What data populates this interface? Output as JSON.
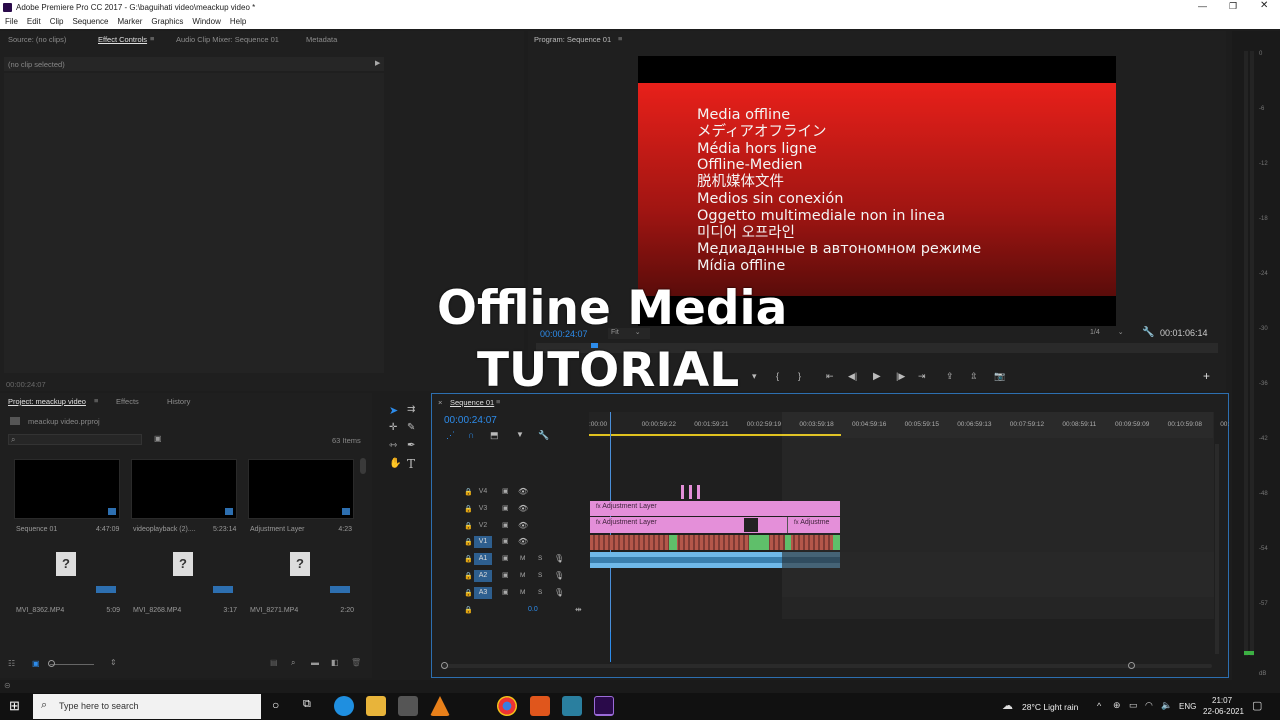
{
  "window": {
    "title": "Adobe Premiere Pro CC 2017 - G:\\baguihati video\\meackup video *"
  },
  "menu": [
    "File",
    "Edit",
    "Clip",
    "Sequence",
    "Marker",
    "Graphics",
    "Window",
    "Help"
  ],
  "source_panel": {
    "tabs": [
      "Source: (no clips)",
      "Effect Controls",
      "Audio Clip Mixer: Sequence 01",
      "Metadata"
    ],
    "no_clip": "(no clip selected)",
    "timecode": "00:00:24:07"
  },
  "program_panel": {
    "title": "Program: Sequence 01",
    "offline_lines": [
      "Media offline",
      "メディアオフライン",
      "Média hors ligne",
      "Offline-Medien",
      "脱机媒体文件",
      "Medios sin conexión",
      "Oggetto multimediale non in linea",
      "미디어 오프라인",
      "Медиаданные в автономном режиме",
      "Mídia offline"
    ],
    "timecode": "00:00:24:07",
    "fit": "Fit",
    "resolution": "1/4",
    "duration": "00:01:06:14"
  },
  "overlay": {
    "line1": "Offline Media",
    "line2": "TUTORIAL"
  },
  "project_panel": {
    "tabs": [
      "Project: meackup video",
      "Effects",
      "History"
    ],
    "file": "meackup video.prproj",
    "count": "63 Items",
    "items": [
      {
        "name": "Sequence 01",
        "dur": "4:47:09",
        "type": "video"
      },
      {
        "name": "videoplayback (2)....",
        "dur": "5:23:14",
        "type": "video"
      },
      {
        "name": "Adjustment Layer",
        "dur": "4:23",
        "type": "video"
      },
      {
        "name": "MVI_8362.MP4",
        "dur": "5:09",
        "type": "missing"
      },
      {
        "name": "MVI_8268.MP4",
        "dur": "3:17",
        "type": "missing"
      },
      {
        "name": "MVI_8271.MP4",
        "dur": "2:20",
        "type": "missing"
      }
    ]
  },
  "timeline": {
    "tab": "Sequence 01",
    "timecode": "00:00:24:07",
    "ruler": [
      ":00:00",
      "00:00:59:22",
      "00:01:59:21",
      "00:02:59:19",
      "00:03:59:18",
      "00:04:59:16",
      "00:05:59:15",
      "00:06:59:13",
      "00:07:59:12",
      "00:08:59:11",
      "00:09:59:09",
      "00:10:59:08",
      "00:"
    ],
    "video_tracks": [
      "V4",
      "V3",
      "V2",
      "V1"
    ],
    "audio_tracks": [
      "A1",
      "A2",
      "A3"
    ],
    "clip_labels": [
      "Adjustment Layer",
      "Adjustment Layer",
      "Adjustme"
    ],
    "master_level": "0.0",
    "meter_ticks": [
      "0",
      "-6",
      "-12",
      "-18",
      "-24",
      "-30",
      "-36",
      "-42",
      "-48",
      "-54",
      "-57",
      "dB"
    ]
  },
  "taskbar": {
    "search_placeholder": "Type here to search",
    "weather": "28°C  Light rain",
    "lang": "ENG",
    "time": "21:07",
    "date": "22-06-2021"
  },
  "colors": {
    "accent": "#2d8ceb",
    "clip_pink": "#e48fd9",
    "offline_red": "#e8201a",
    "audio": "#6fb8e8"
  }
}
